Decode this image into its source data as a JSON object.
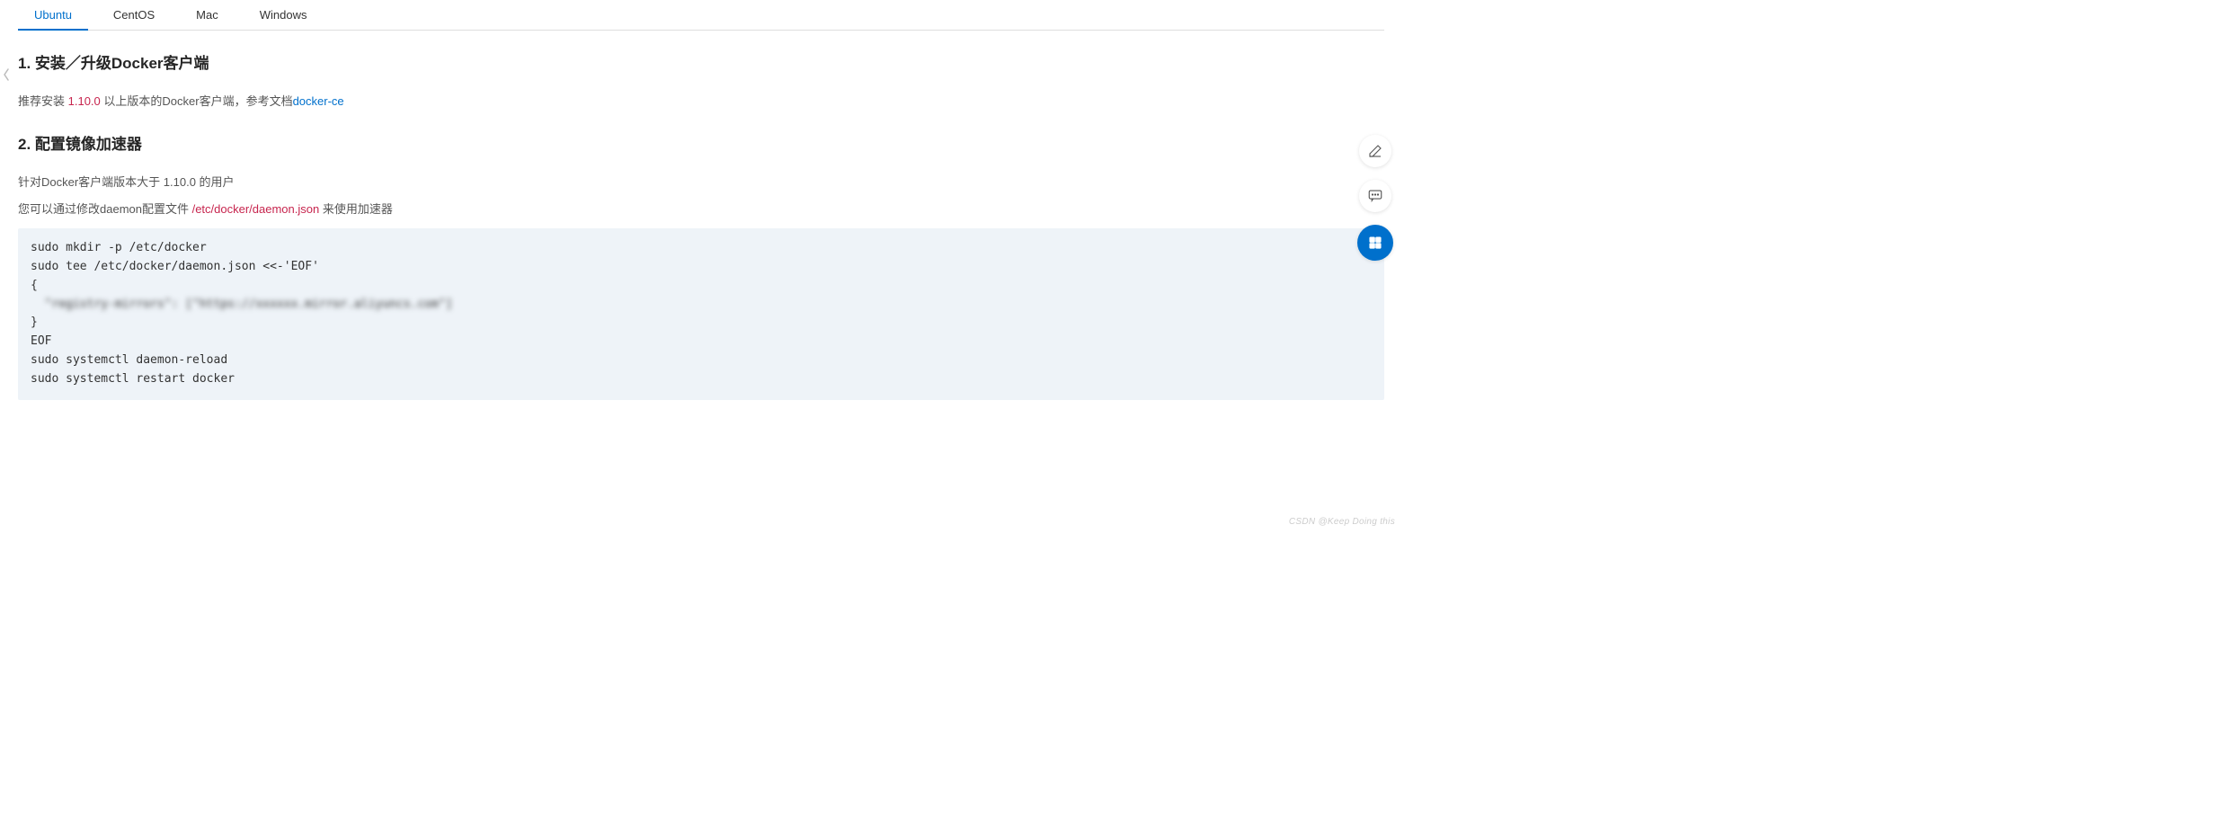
{
  "tabs": [
    {
      "label": "Ubuntu",
      "active": true
    },
    {
      "label": "CentOS",
      "active": false
    },
    {
      "label": "Mac",
      "active": false
    },
    {
      "label": "Windows",
      "active": false
    }
  ],
  "section1": {
    "title": "1. 安装／升级Docker客户端",
    "text_prefix": "推荐安装 ",
    "version": "1.10.0",
    "text_mid": " 以上版本的Docker客户端，参考文档",
    "link_label": "docker-ce"
  },
  "section2": {
    "title": "2. 配置镜像加速器",
    "line1": "针对Docker客户端版本大于 1.10.0 的用户",
    "line2_prefix": "您可以通过修改daemon配置文件 ",
    "config_path": "/etc/docker/daemon.json",
    "line2_suffix": " 来使用加速器"
  },
  "code_lines": [
    "sudo mkdir -p /etc/docker",
    "sudo tee /etc/docker/daemon.json <<-'EOF'",
    "{",
    "  \"registry-mirrors\": [\"https://xxxxxx.mirror.aliyuncs.com\"]",
    "}",
    "EOF",
    "sudo systemctl daemon-reload",
    "sudo systemctl restart docker"
  ],
  "watermark": "CSDN @Keep Doing this"
}
